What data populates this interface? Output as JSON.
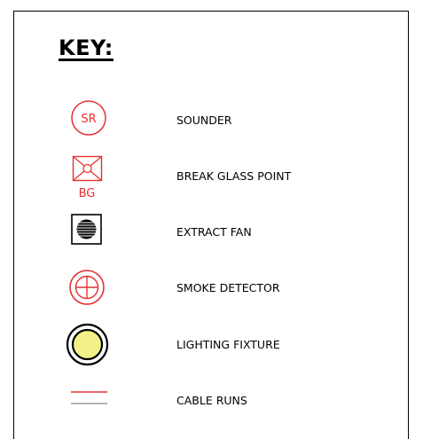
{
  "title": "KEY:",
  "colors": {
    "red": "#e53030",
    "fixture_fill": "#f2f086",
    "black": "#000000",
    "grey": "#9a9a9a"
  },
  "legend": [
    {
      "label": "SOUNDER",
      "symbol_text": "SR",
      "icon": "sounder-icon"
    },
    {
      "label": "BREAK GLASS POINT",
      "symbol_text": "BG",
      "icon": "break-glass-point-icon"
    },
    {
      "label": "EXTRACT FAN",
      "icon": "extract-fan-icon"
    },
    {
      "label": "SMOKE DETECTOR",
      "icon": "smoke-detector-icon"
    },
    {
      "label": "LIGHTING FIXTURE",
      "icon": "lighting-fixture-icon"
    },
    {
      "label": "CABLE RUNS",
      "icon": "cable-runs-icon"
    }
  ]
}
